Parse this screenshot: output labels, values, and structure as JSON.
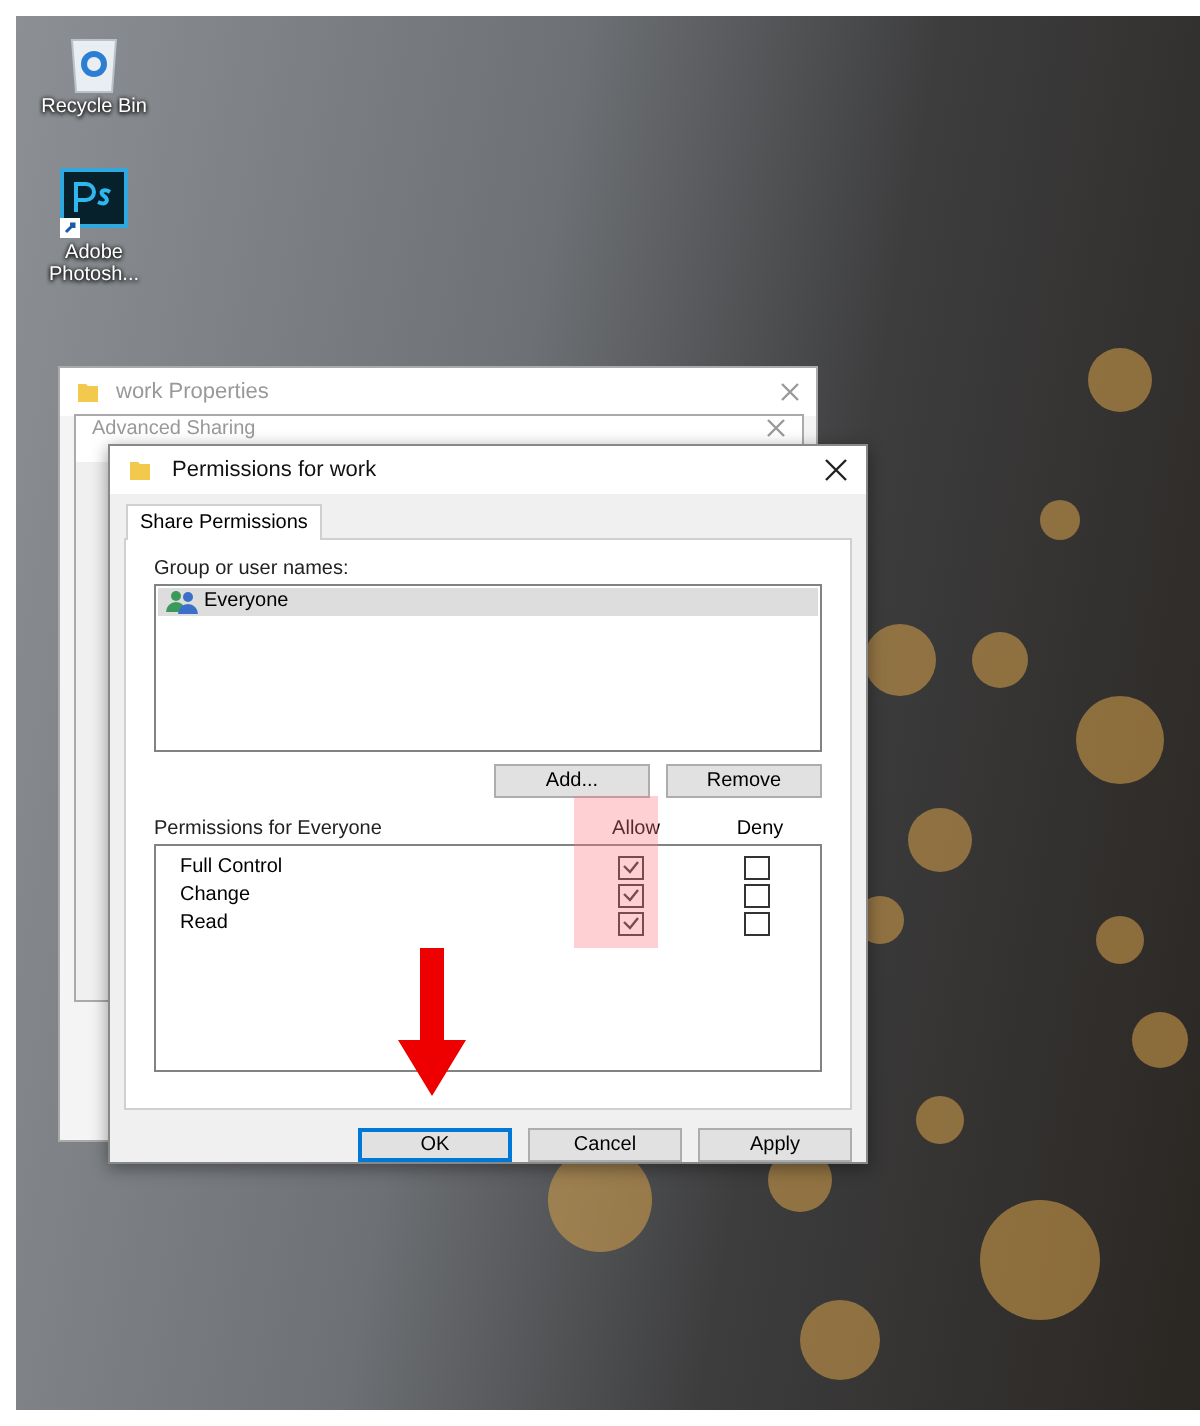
{
  "desktop_icons": [
    {
      "label": "Recycle Bin",
      "kind": "recycle-bin"
    },
    {
      "label": "Adobe Photosh...",
      "kind": "photoshop"
    }
  ],
  "background_windows": [
    {
      "title": "work Properties"
    },
    {
      "title": "Advanced Sharing"
    }
  ],
  "dialog": {
    "title": "Permissions for work",
    "tabs": [
      {
        "label": "Share Permissions",
        "selected": true
      }
    ],
    "group_label": "Group or user names:",
    "users": [
      {
        "name": "Everyone",
        "selected": true
      }
    ],
    "user_buttons": [
      "Add...",
      "Remove"
    ],
    "permissions_label": "Permissions for Everyone",
    "columns": [
      "Allow",
      "Deny"
    ],
    "permissions": [
      {
        "name": "Full Control",
        "allow": true,
        "deny": false
      },
      {
        "name": "Change",
        "allow": true,
        "deny": false
      },
      {
        "name": "Read",
        "allow": true,
        "deny": false
      }
    ],
    "buttons": [
      {
        "label": "OK",
        "default": true
      },
      {
        "label": "Cancel",
        "default": false
      },
      {
        "label": "Apply",
        "default": false
      }
    ]
  }
}
